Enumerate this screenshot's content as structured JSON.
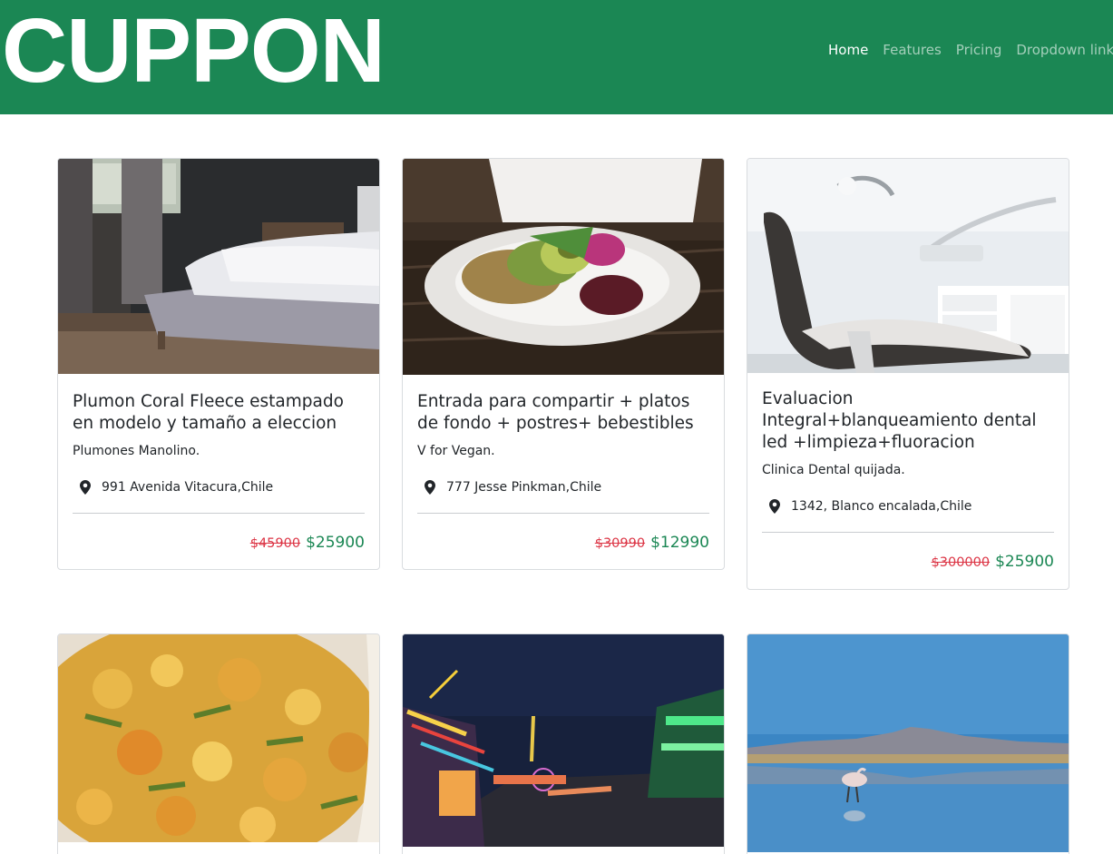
{
  "brand": "CUPPON",
  "nav": {
    "home": "Home",
    "features": "Features",
    "pricing": "Pricing",
    "dropdown": "Dropdown link"
  },
  "colors": {
    "primary": "#1b8754",
    "old_price": "#dc3545"
  },
  "cards": [
    {
      "title": "Plumon Coral Fleece estampado en modelo y tamaño a eleccion",
      "vendor": "Plumones Manolino.",
      "location": "991 Avenida Vitacura,Chile",
      "old_price": "$45900",
      "new_price": "$25900",
      "image": "bedroom-photo"
    },
    {
      "title": "Entrada para compartir + platos de fondo + postres+ bebestibles",
      "vendor": "V for Vegan.",
      "location": "777 Jesse Pinkman,Chile",
      "old_price": "$30990",
      "new_price": "$12990",
      "image": "vegan-dish-photo"
    },
    {
      "title": "Evaluacion Integral+blanqueamiento dental led +limpieza+fluoracion",
      "vendor": "Clinica Dental quijada.",
      "location": "1342, Blanco encalada,Chile",
      "old_price": "$300000",
      "new_price": "$25900",
      "image": "dental-chair-photo"
    },
    {
      "image": "food-stew-photo"
    },
    {
      "image": "night-fair-photo"
    },
    {
      "image": "flamingo-lake-photo"
    }
  ]
}
